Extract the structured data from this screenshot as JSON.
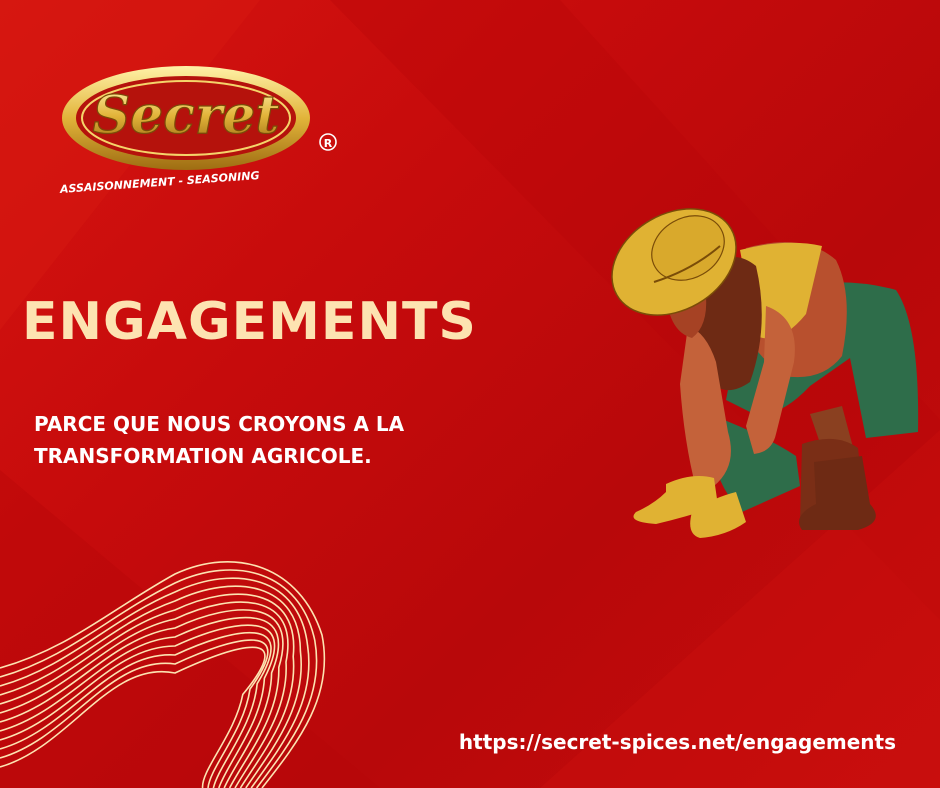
{
  "brand": {
    "name": "Secret",
    "registered_mark": "R",
    "tagline": "ASSAISONNEMENT - SEASONING"
  },
  "headline": "ENGAGEMENTS",
  "subtitle_lines": [
    "PARCE QUE NOUS CROYONS A LA",
    "TRANSFORMATION AGRICOLE."
  ],
  "url": "https://secret-spices.net/engagements",
  "colors": {
    "background": "#c60b0c",
    "headline": "#fde3b1",
    "text": "#ffffff",
    "gold": "#e2b43a"
  },
  "illustration": "farmer-planting-icon"
}
